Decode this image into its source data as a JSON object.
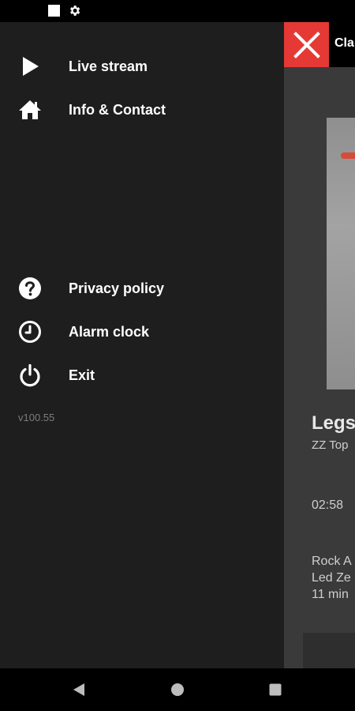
{
  "statusbar": {
    "icons": [
      "square-notification-icon",
      "gear-icon"
    ]
  },
  "drawer": {
    "items": [
      {
        "label": "Live stream",
        "icon": "play-icon"
      },
      {
        "label": "Info & Contact",
        "icon": "home-icon"
      },
      {
        "label": "Privacy policy",
        "icon": "help-circle-icon"
      },
      {
        "label": "Alarm clock",
        "icon": "clock-icon"
      },
      {
        "label": "Exit",
        "icon": "power-icon"
      }
    ],
    "version": "v100.55"
  },
  "background": {
    "title": "Cla",
    "song_title": "Legs",
    "artist": "ZZ Top",
    "elapsed": "02:58",
    "next_lines": [
      "Rock A",
      "Led Ze",
      "11 min"
    ],
    "colors": {
      "close_button": "#e53935",
      "accent": "#d64b3a"
    }
  },
  "navbar": {
    "icons": [
      "back-icon",
      "home-circle-icon",
      "recents-icon"
    ]
  }
}
